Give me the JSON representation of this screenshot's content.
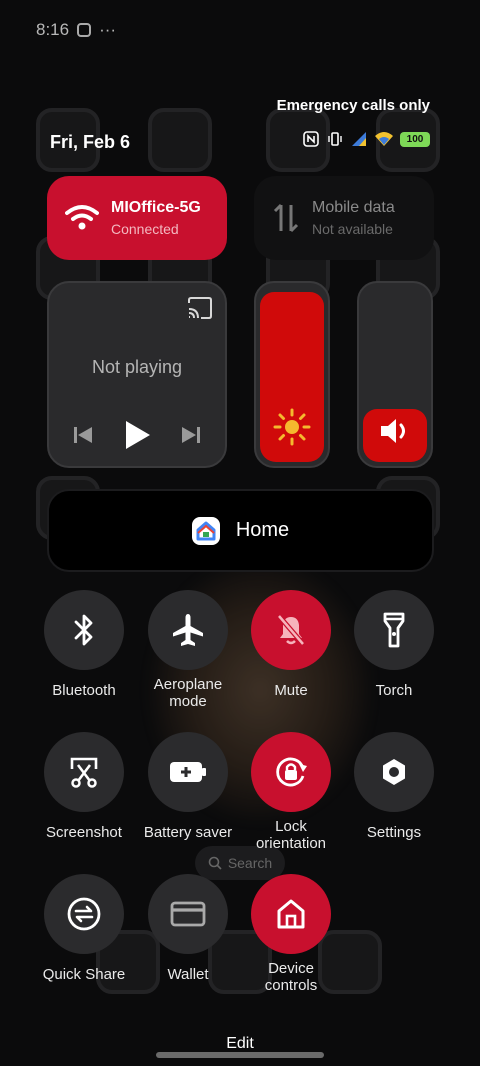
{
  "status_bar": {
    "time": "8:16",
    "more": "···"
  },
  "network_status": "Emergency calls only",
  "date": "Fri, Feb 6",
  "battery": "100",
  "wifi": {
    "name": "MIOffice-5G",
    "status": "Connected"
  },
  "mobile_data": {
    "name": "Mobile data",
    "status": "Not available"
  },
  "media": {
    "status": "Not playing"
  },
  "brightness_level": 0.97,
  "volume_level": 0.3,
  "home_tile": {
    "label": "Home"
  },
  "toggles": [
    {
      "id": "bluetooth",
      "label": "Bluetooth",
      "on": false
    },
    {
      "id": "aeroplane",
      "label": "Aeroplane mode",
      "on": false
    },
    {
      "id": "mute",
      "label": "Mute",
      "on": true
    },
    {
      "id": "torch",
      "label": "Torch",
      "on": false
    },
    {
      "id": "screenshot",
      "label": "Screenshot",
      "on": false
    },
    {
      "id": "battery-saver",
      "label": "Battery saver",
      "on": false
    },
    {
      "id": "lock-orientation",
      "label": "Lock orientation",
      "on": true
    },
    {
      "id": "settings",
      "label": "Settings",
      "on": false
    },
    {
      "id": "quick-share",
      "label": "Quick Share",
      "on": false
    },
    {
      "id": "wallet",
      "label": "Wallet",
      "on": false
    },
    {
      "id": "device-controls",
      "label": "Device controls",
      "on": true
    }
  ],
  "background": {
    "search_label": "Search"
  },
  "edit_label": "Edit",
  "colors": {
    "accent": "#c8102e",
    "slider_fill": "#d00a0a",
    "tile": "#2b2b2d"
  }
}
